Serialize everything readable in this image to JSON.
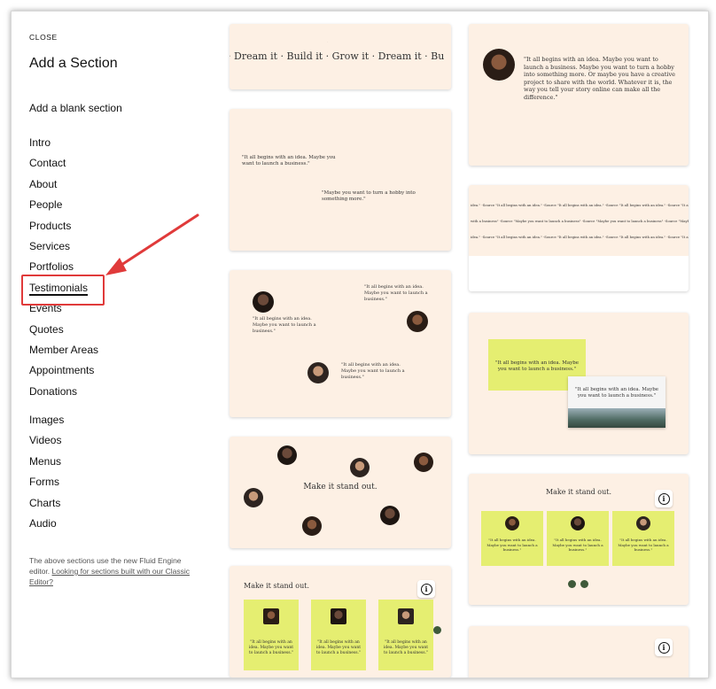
{
  "panel": {
    "close_label": "CLOSE",
    "title": "Add a Section",
    "blank_label": "Add a blank section",
    "nav_group_1": [
      "Intro",
      "Contact",
      "About",
      "People",
      "Products",
      "Services",
      "Portfolios",
      "Testimonials",
      "Events",
      "Quotes",
      "Member Areas",
      "Appointments",
      "Donations"
    ],
    "nav_group_2": [
      "Images",
      "Videos",
      "Menus",
      "Forms",
      "Charts",
      "Audio"
    ],
    "selected": "Testimonials",
    "note_text": "The above sections use the new Fluid Engine editor. ",
    "note_link": "Looking for sections built with our Classic Editor?",
    "highlight_color": "#e03a3a"
  },
  "previews": {
    "marquee_text": "· Dream it · Build it · Grow it · Dream it · Bu",
    "card2_quote_a": "\"It all begins with an idea. Maybe you want to launch a business.\"",
    "card2_quote_b": "\"Maybe you want to turn a hobby into something more.\"",
    "card3_quote_a": "\"It all begins with an idea. Maybe you want to launch a business.\"",
    "card3_quote_b": "\"It all begins with an idea. Maybe you want to launch a business.\"",
    "card3_quote_c": "\"It all begins with an idea. Maybe you want to launch a business.\"",
    "card4_heading": "Make it stand out.",
    "card5_heading": "Make it stand out.",
    "card5_quote": "\"It all begins with an idea. Maybe you want to launch a business.\"",
    "right1_quote": "\"It all begins with an idea. Maybe you want to launch a business. Maybe you want to turn a hobby into something more. Or maybe you have a creative project to share with the world. Whatever it is, the way you tell your story online can make all the difference.\"",
    "right2_rows": [
      "idea.\" -Source  \"It all begins with an idea.\" -Source  \"It all begins with an idea.\" -Source  \"It all begins with an idea.\" -Source  \"It all begins",
      "with a business\" -Source  \"Maybe you want to launch a business\" -Source  \"Maybe you want to launch a business\" -Source  \"Maybe",
      "idea.\" -Source  \"It all begins with an idea.\" -Source  \"It all begins with an idea.\" -Source  \"It all begins with an idea.\" -Source  \"It all begins"
    ],
    "right3_quote_a": "\"It all begins with an idea. Maybe you want to launch a business.\"",
    "right3_quote_b": "\"It all begins with an idea. Maybe you want to launch a business.\"",
    "right4_heading": "Make it stand out.",
    "right4_quote": "\"It all begins with an idea. Maybe you want to launch a business.\"",
    "info_glyph": "i",
    "accent_yellow": "#e5ee71",
    "card_bg": "#fdf0e4"
  }
}
